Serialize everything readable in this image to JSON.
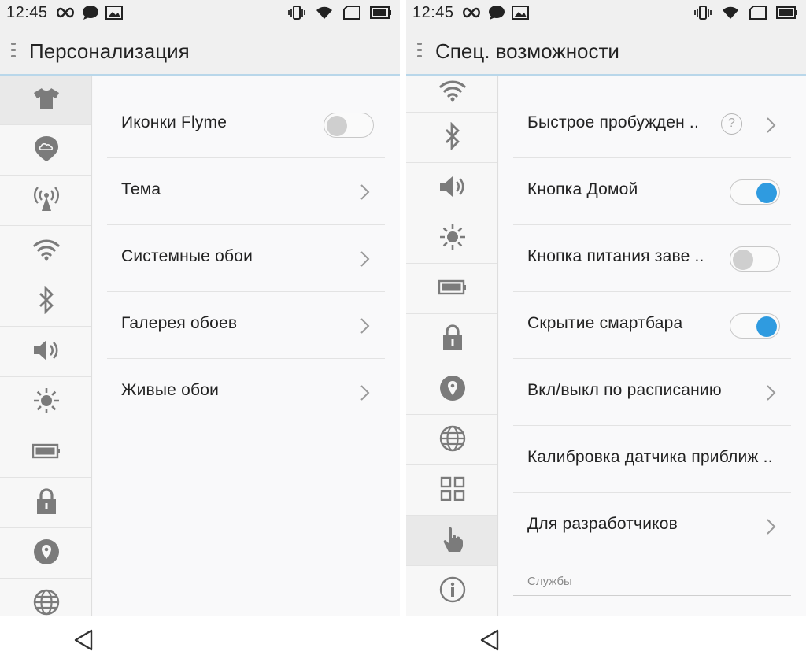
{
  "status_bar": {
    "time": "12:45",
    "icons_left": [
      "infinity-icon",
      "message-bubble-icon",
      "image-icon"
    ],
    "icons_right": [
      "vibrate-icon",
      "wifi-icon",
      "sim-card-icon",
      "battery-icon"
    ]
  },
  "left_screen": {
    "title": "Персонализация",
    "sidebar": [
      {
        "icon": "tshirt-icon",
        "active": true
      },
      {
        "icon": "cloud-location-icon",
        "active": false
      },
      {
        "icon": "hotspot-icon",
        "active": false
      },
      {
        "icon": "wifi-icon",
        "active": false
      },
      {
        "icon": "bluetooth-icon",
        "active": false
      },
      {
        "icon": "volume-icon",
        "active": false
      },
      {
        "icon": "brightness-icon",
        "active": false
      },
      {
        "icon": "battery-icon",
        "active": false
      },
      {
        "icon": "lock-icon",
        "active": false
      },
      {
        "icon": "location-pin-icon",
        "active": false
      },
      {
        "icon": "globe-icon",
        "active": false
      }
    ],
    "rows": [
      {
        "label": "Иконки Flyme",
        "control": "toggle",
        "on": false
      },
      {
        "label": "Тема",
        "control": "chevron"
      },
      {
        "label": "Системные обои",
        "control": "chevron"
      },
      {
        "label": "Галерея обоев",
        "control": "chevron"
      },
      {
        "label": "Живые обои",
        "control": "chevron"
      }
    ]
  },
  "right_screen": {
    "title": "Спец. возможности",
    "sidebar": [
      {
        "icon": "wifi-icon",
        "active": false
      },
      {
        "icon": "bluetooth-icon",
        "active": false
      },
      {
        "icon": "volume-icon",
        "active": false
      },
      {
        "icon": "brightness-icon",
        "active": false
      },
      {
        "icon": "battery-icon",
        "active": false
      },
      {
        "icon": "lock-icon",
        "active": false
      },
      {
        "icon": "location-pin-icon",
        "active": false
      },
      {
        "icon": "globe-icon",
        "active": false
      },
      {
        "icon": "apps-grid-icon",
        "active": false
      },
      {
        "icon": "hand-pointer-icon",
        "active": true
      },
      {
        "icon": "info-icon",
        "active": false
      }
    ],
    "rows": [
      {
        "label": "Быстрое пробужден ..",
        "control": "chevron",
        "help": "?"
      },
      {
        "label": "Кнопка Домой",
        "control": "toggle",
        "on": true
      },
      {
        "label": "Кнопка питания заве ..",
        "control": "toggle",
        "on": false
      },
      {
        "label": "Скрытие смартбара",
        "control": "toggle",
        "on": true
      },
      {
        "label": "Вкл/выкл по расписанию",
        "control": "chevron"
      },
      {
        "label": "Калибровка датчика приближ ..",
        "control": "none"
      },
      {
        "label": "Для разработчиков",
        "control": "chevron"
      }
    ],
    "section_header": "Службы"
  },
  "nav_bar": {
    "back_icon": "back-triangle-icon"
  },
  "colors": {
    "accent": "#2f9be0",
    "divider": "#e3e3e3",
    "appbar_line": "#b9d7ea",
    "icon_gray": "#7b7b7b"
  }
}
